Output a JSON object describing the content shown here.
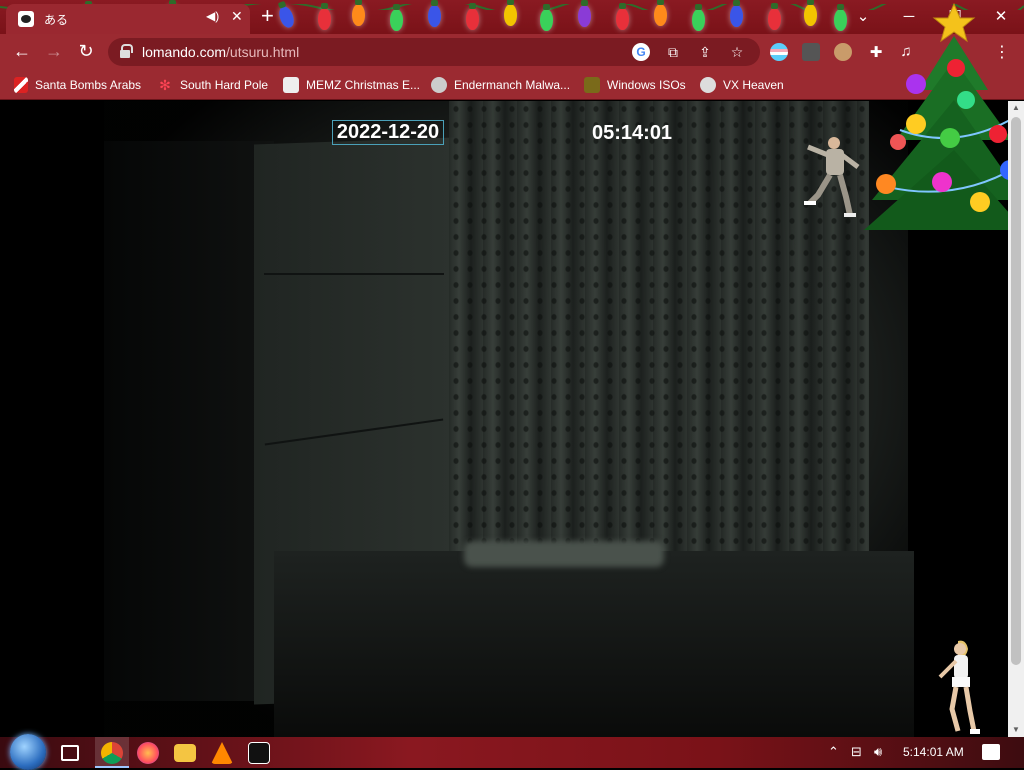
{
  "tab": {
    "title": "ある"
  },
  "toolbar": {
    "url_domain": "lomando.com",
    "url_path": "/utsuru.html"
  },
  "bookmarks": [
    {
      "label": "Santa Bombs Arabs"
    },
    {
      "label": "South Hard Pole"
    },
    {
      "label": "MEMZ Christmas E..."
    },
    {
      "label": "Endermanch Malwa..."
    },
    {
      "label": "Windows ISOs"
    },
    {
      "label": "VX Heaven"
    }
  ],
  "page": {
    "date": "2022-12-20",
    "time": "05:14:01"
  },
  "taskbar": {
    "clock": "5:14:01 AM"
  },
  "colors": {
    "chrome_frame": "#8a1a22",
    "chrome_toolbar": "#9b2a31",
    "page_bg": "#000000",
    "date_border": "#4aa0b8"
  },
  "icons": {
    "window": [
      "back-icon",
      "forward-icon",
      "reload-icon",
      "lock-icon",
      "google-icon",
      "translate-icon",
      "share-icon",
      "star-icon",
      "extensions-icon",
      "media-icon",
      "menu-icon"
    ]
  }
}
